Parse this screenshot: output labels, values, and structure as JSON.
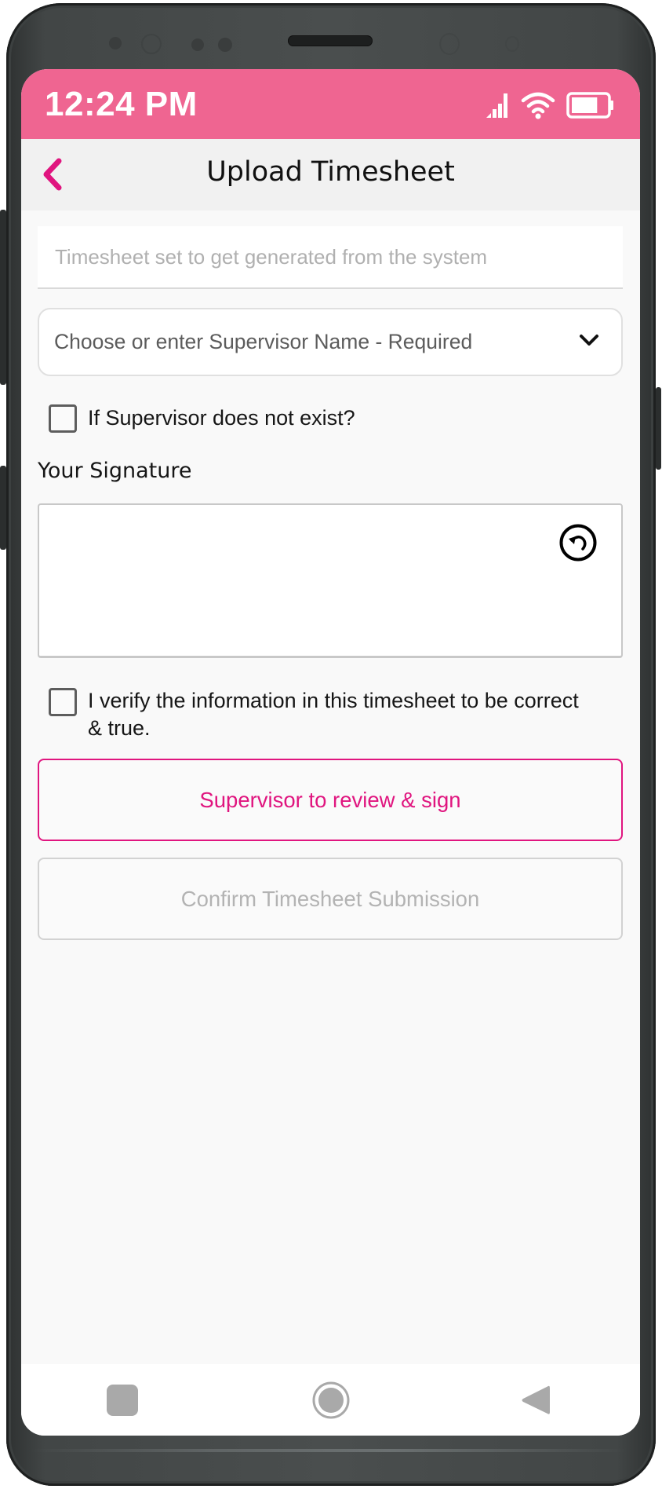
{
  "status_bar": {
    "time": "12:24 PM",
    "icons": [
      "signal-icon",
      "wifi-icon",
      "battery-icon"
    ],
    "battery_level": 0.75,
    "background_color": "#ef6591"
  },
  "header": {
    "back_icon": "chevron-left-icon",
    "title": "Upload Timesheet",
    "accent_color": "#e0157f"
  },
  "form": {
    "timesheet_field": {
      "value": "",
      "placeholder": "Timesheet set to get generated from the system"
    },
    "supervisor_dropdown": {
      "selected": "",
      "placeholder": "Choose or enter Supervisor Name - Required",
      "icon": "chevron-down-icon"
    },
    "supervisor_missing_checkbox": {
      "label": "If Supervisor does not exist?",
      "checked": false
    },
    "signature": {
      "label": "Your Signature",
      "clear_icon": "undo-icon"
    },
    "verify_checkbox": {
      "label": "I verify the information in this timesheet to be correct & true.",
      "checked": false
    }
  },
  "buttons": {
    "review": "Supervisor to review & sign",
    "confirm": "Confirm Timesheet Submission",
    "confirm_enabled": false
  },
  "nav_bar": {
    "items": [
      "recent-apps-icon",
      "home-icon",
      "back-icon"
    ]
  }
}
